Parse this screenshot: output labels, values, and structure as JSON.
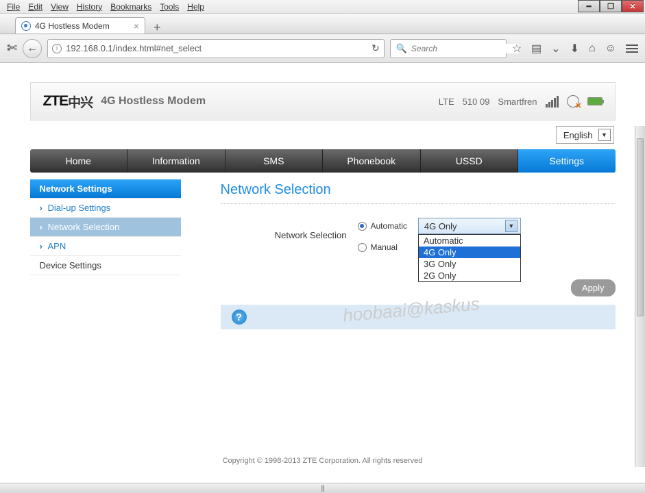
{
  "menubar": [
    "File",
    "Edit",
    "View",
    "History",
    "Bookmarks",
    "Tools",
    "Help"
  ],
  "tab": {
    "title": "4G Hostless Modem"
  },
  "url": "192.168.0.1/index.html#net_select",
  "search_placeholder": "Search",
  "header": {
    "logo": "ZTE",
    "logo_cn": "中兴",
    "product": "4G Hostless Modem",
    "status": {
      "net": "LTE",
      "plmn": "510 09",
      "operator": "Smartfren"
    }
  },
  "language": "English",
  "nav": [
    "Home",
    "Information",
    "SMS",
    "Phonebook",
    "USSD",
    "Settings"
  ],
  "nav_active": 5,
  "sidebar": {
    "head": "Network Settings",
    "subs": [
      "Dial-up Settings",
      "Network Selection",
      "APN"
    ],
    "sub_active": 1,
    "head2": "Device Settings"
  },
  "content": {
    "title": "Network Selection",
    "label": "Network Selection",
    "radio_auto": "Automatic",
    "radio_manual": "Manual",
    "select_value": "4G Only",
    "options": [
      "Automatic",
      "4G Only",
      "3G Only",
      "2G Only"
    ],
    "option_hl": 1,
    "apply": "Apply"
  },
  "watermark": "hoobaai@kaskus",
  "footer": "Copyright © 1998-2013 ZTE Corporation. All rights reserved"
}
